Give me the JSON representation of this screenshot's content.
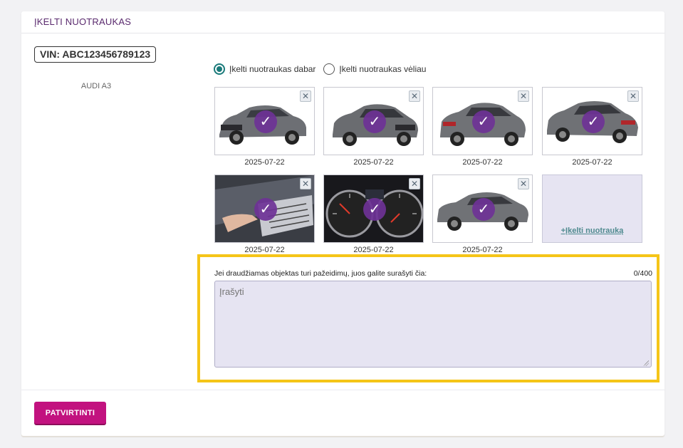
{
  "header": {
    "title": "ĮKELTI NUOTRAUKAS"
  },
  "vehicle": {
    "vin": "VIN: ABC123456789123",
    "model": "AUDI A3"
  },
  "upload_options": [
    {
      "label": "Įkelti nuotraukas dabar",
      "checked": true
    },
    {
      "label": "Įkelti nuotraukas vėliau",
      "checked": false
    }
  ],
  "photos": [
    {
      "date": "2025-07-22",
      "subject": "car-front-left"
    },
    {
      "date": "2025-07-22",
      "subject": "car-front-right"
    },
    {
      "date": "2025-07-22",
      "subject": "car-rear-left"
    },
    {
      "date": "2025-07-22",
      "subject": "car-rear-right"
    },
    {
      "date": "2025-07-22",
      "subject": "vin-plate"
    },
    {
      "date": "2025-07-22",
      "subject": "dashboard-odometer"
    },
    {
      "date": "2025-07-22",
      "subject": "car-side"
    }
  ],
  "upload_tile": {
    "label": "+Įkelti nuotrauką"
  },
  "damage": {
    "label": "Jei draudžiamas objektas turi pažeidimų, juos galite surašyti čia:",
    "counter": "0/400",
    "placeholder": "Įrašyti"
  },
  "actions": {
    "confirm_label": "PATVIRTINTI"
  },
  "colors": {
    "accent": "#c2127f",
    "header_text": "#5a2a6e",
    "highlight": "#f5c518",
    "radio": "#1a7a7a"
  }
}
